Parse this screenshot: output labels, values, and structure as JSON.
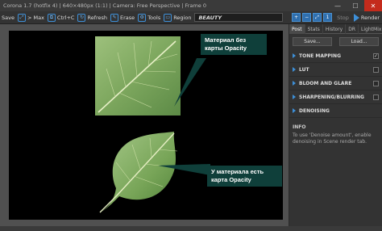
{
  "window": {
    "title": "Corona 1.7 (hotfix 4) | 640×480px (1:1) | Camera: Free Perspective | Frame 0",
    "minimize": "—",
    "maximize": "☐",
    "close": "✕"
  },
  "toolbar": {
    "save": "Save",
    "max": "> Max",
    "copy": "Ctrl+C",
    "refresh": "Refresh",
    "erase": "Erase",
    "tools": "Tools",
    "region": "Region",
    "render_element": "BEAUTY",
    "stop": "Stop",
    "render": "Render"
  },
  "viewport": {
    "callout_top": "Материал без карты Opacity",
    "callout_bottom": "У материала есть карта Opacity"
  },
  "panel": {
    "tabs": [
      "Post",
      "Stats",
      "History",
      "DR",
      "LightMix"
    ],
    "save_button": "Save...",
    "load_button": "Load...",
    "sections": [
      {
        "label": "TONE MAPPING",
        "checked": true
      },
      {
        "label": "LUT",
        "checked": false
      },
      {
        "label": "BLOOM AND GLARE",
        "checked": false
      },
      {
        "label": "SHARPENING/BLURRING",
        "checked": false
      },
      {
        "label": "DENOISING",
        "checked": false
      }
    ],
    "info_title": "INFO",
    "info_text": "To use 'Denoise amount', enable denoising in Scene render tab."
  },
  "colors": {
    "accent": "#3d8fd8",
    "callout_bg": "#0f3f3a",
    "close_button": "#c42b1c"
  }
}
